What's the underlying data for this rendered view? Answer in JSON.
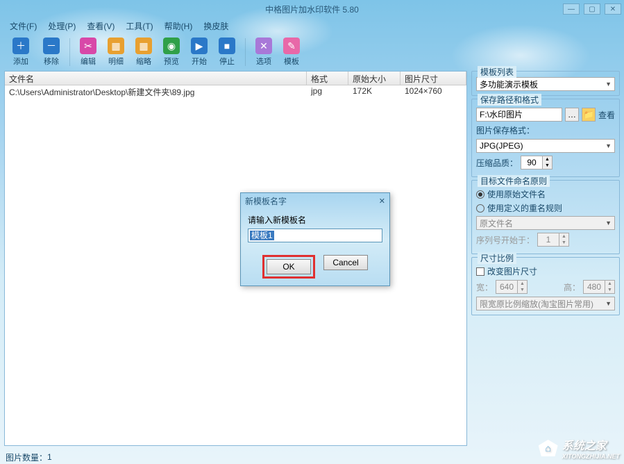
{
  "title": "中格图片加水印软件 5.80",
  "menu": [
    "文件(F)",
    "处理(P)",
    "查看(V)",
    "工具(T)",
    "帮助(H)",
    "换皮肤"
  ],
  "toolbar": [
    {
      "label": "添加",
      "color": "#2a78c8",
      "glyph": "＋"
    },
    {
      "label": "移除",
      "color": "#2a78c8",
      "glyph": "－"
    },
    {
      "label": "编辑",
      "color": "#d848a8",
      "glyph": "✂"
    },
    {
      "label": "明细",
      "color": "#e8a030",
      "glyph": "▦"
    },
    {
      "label": "缩略",
      "color": "#e8a030",
      "glyph": "▦"
    },
    {
      "label": "预览",
      "color": "#30a048",
      "glyph": "◉"
    },
    {
      "label": "开始",
      "color": "#2a78c8",
      "glyph": "▶"
    },
    {
      "label": "停止",
      "color": "#2a78c8",
      "glyph": "■"
    },
    {
      "label": "选项",
      "color": "#a878d8",
      "glyph": "✕"
    },
    {
      "label": "模板",
      "color": "#e868a8",
      "glyph": "🎨"
    }
  ],
  "table": {
    "headers": {
      "name": "文件名",
      "fmt": "格式",
      "size": "原始大小",
      "dim": "图片尺寸"
    },
    "rows": [
      {
        "name": "C:\\Users\\Administrator\\Desktop\\新建文件夹\\89.jpg",
        "fmt": "jpg",
        "size": "172K",
        "dim": "1024×760"
      }
    ]
  },
  "right": {
    "templateList": {
      "title": "模板列表",
      "value": "多功能演示模板"
    },
    "savePath": {
      "title": "保存路径和格式",
      "path": "F:\\水印图片",
      "viewBtn": "查看",
      "fmtLabel": "图片保存格式：",
      "fmtValue": "JPG(JPEG)",
      "qualityLabel": "压缩品质：",
      "quality": "90"
    },
    "naming": {
      "title": "目标文件命名原则",
      "opt1": "使用原始文件名",
      "opt2": "使用定义的重名规则",
      "ruleValue": "原文件名",
      "seqLabel": "序列号开始于：",
      "seqValue": "1"
    },
    "size": {
      "title": "尺寸比例",
      "checkLabel": "改变图片尺寸",
      "widthLabel": "宽：",
      "width": "640",
      "heightLabel": "高：",
      "height": "480",
      "modeValue": "限宽原比例缩放(淘宝图片常用)"
    }
  },
  "dialog": {
    "title": "新模板名字",
    "prompt": "请输入新模板名",
    "value": "模板1",
    "ok": "OK",
    "cancel": "Cancel"
  },
  "status": {
    "count_label": "图片数量：",
    "count": "1"
  },
  "watermark": {
    "text": "系统之家",
    "url": "XITONGZHIJIA.NET"
  }
}
